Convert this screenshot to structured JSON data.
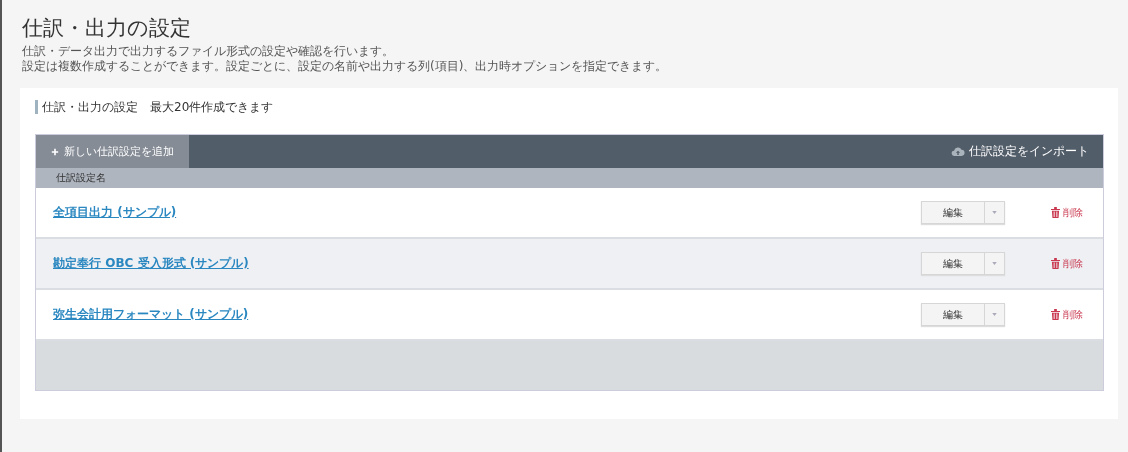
{
  "page": {
    "title": "仕訳・出力の設定",
    "descriptions": [
      "仕訳・データ出力で出力するファイル形式の設定や確認を行います。",
      "設定は複数作成することができます。設定ごとに、設定の名前や出力する列(項目)、出力時オプションを指定できます。"
    ]
  },
  "section": {
    "title": "仕訳・出力の設定　最大20件作成できます"
  },
  "toolbar": {
    "add_button": "新しい仕訳設定を追加",
    "import_button": "仕訳設定をインポート"
  },
  "table": {
    "columns": [
      "仕訳設定名"
    ],
    "rows": [
      {
        "name": "全項目出力 (サンプル)",
        "highlighted": false,
        "edit_button": "編集",
        "delete_button": "削除"
      },
      {
        "name": "勘定奉行 OBC 受入形式 (サンプル)",
        "highlighted": true,
        "edit_button": "編集",
        "delete_button": "削除"
      },
      {
        "name": "弥生会計用フォーマット (サンプル)",
        "highlighted": false,
        "edit_button": "編集",
        "delete_button": "削除"
      }
    ]
  }
}
